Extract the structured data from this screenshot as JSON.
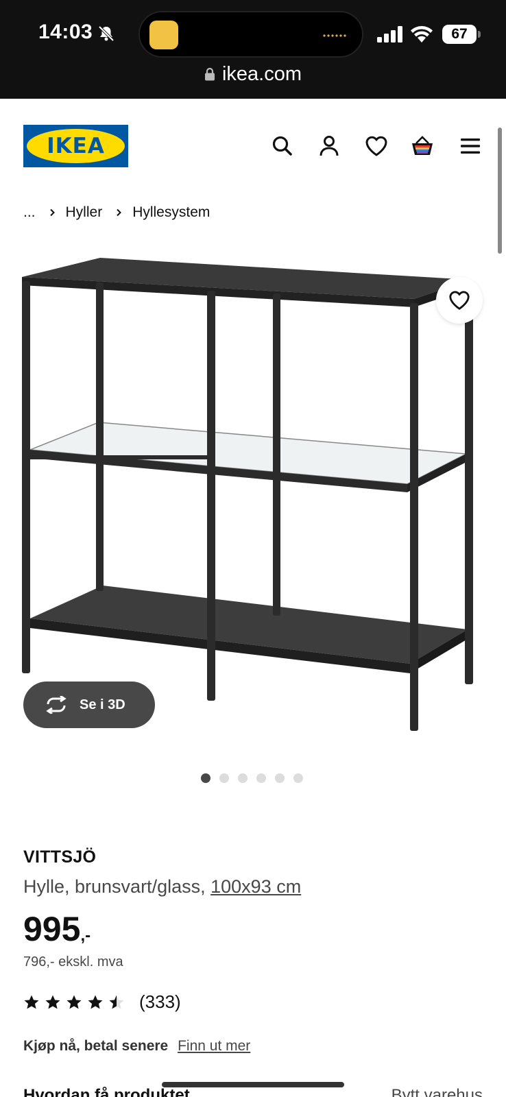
{
  "status_bar": {
    "time": "14:03",
    "battery": "67",
    "url": "ikea.com"
  },
  "header": {
    "logo_text": "IKEA",
    "icons": [
      "search-icon",
      "account-icon",
      "favourites-icon",
      "basket-icon",
      "menu-icon"
    ]
  },
  "breadcrumb": {
    "ellipsis": "...",
    "items": [
      "Hyller",
      "Hyllesystem"
    ]
  },
  "gallery": {
    "view_3d_label": "Se i 3D",
    "image_count": 6,
    "active_index": 0
  },
  "product": {
    "name": "VITTSJÖ",
    "description": "Hylle, brunsvart/glass,",
    "size": "100x93 cm",
    "price": "995",
    "price_suffix": ",-",
    "price_ex_vat": "796,- ekskl. mva",
    "rating": 4.5,
    "rating_count": "(333)"
  },
  "financing": {
    "label": "Kjøp nå, betal senere",
    "link": "Finn ut mer"
  },
  "delivery": {
    "heading": "Hvordan få produktet",
    "store_link": "Bytt varehus"
  },
  "colors": {
    "ikea_blue": "#0058a3",
    "ikea_yellow": "#ffdb00",
    "dark_button": "#484848"
  }
}
